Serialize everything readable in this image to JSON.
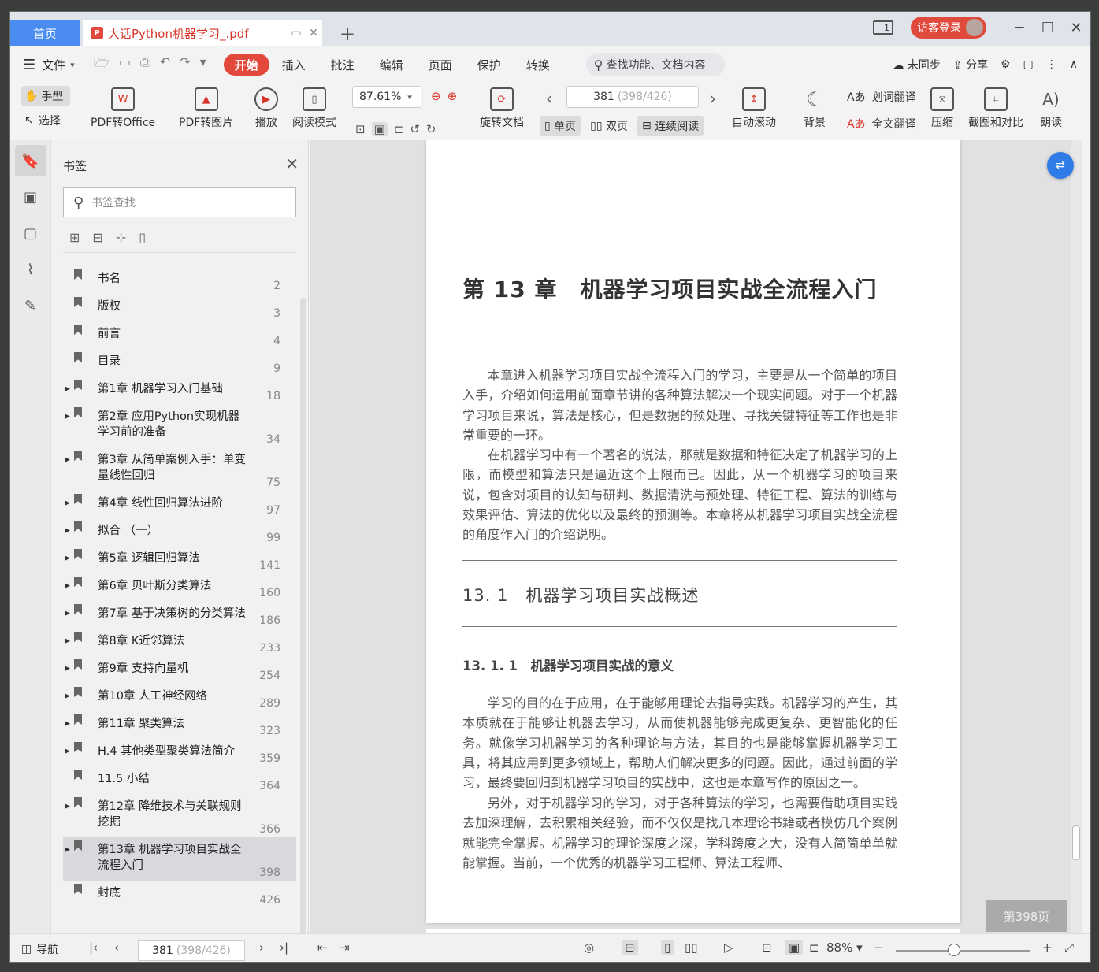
{
  "titlebar": {
    "home_tab": "首页",
    "doc_tab": "大话Python机器学习_.pdf",
    "pdf_badge": "P",
    "login": "访客登录",
    "page_indicator": "1"
  },
  "menu": {
    "file": "文件",
    "tabs": [
      "开始",
      "插入",
      "批注",
      "编辑",
      "页面",
      "保护",
      "转换"
    ],
    "search_placeholder": "查找功能、文档内容",
    "sync": "未同步",
    "share": "分享"
  },
  "toolbar": {
    "hand": "手型",
    "select": "选择",
    "pdf_to_office": "PDF转Office",
    "pdf_to_image": "PDF转图片",
    "play": "播放",
    "read_mode": "阅读模式",
    "zoom": "87.61%",
    "rotate": "旋转文档",
    "page_current": "381",
    "page_detail": "(398/426)",
    "single": "单页",
    "double": "双页",
    "continuous": "连续阅读",
    "auto_scroll": "自动滚动",
    "background": "背景",
    "word_translate": "划词翻译",
    "full_translate": "全文翻译",
    "compress": "压缩",
    "screenshot_compare": "截图和对比",
    "read_aloud": "朗读"
  },
  "panel": {
    "title": "书签",
    "search_placeholder": "书签查找",
    "items": [
      {
        "label": "书名",
        "page": "2",
        "expand": false
      },
      {
        "label": "版权",
        "page": "3",
        "expand": false
      },
      {
        "label": "前言",
        "page": "4",
        "expand": false
      },
      {
        "label": "目录",
        "page": "9",
        "expand": false
      },
      {
        "label": "第1章 机器学习入门基础",
        "page": "18",
        "expand": true
      },
      {
        "label": "第2章 应用Python实现机器学习前的准备",
        "page": "34",
        "expand": true
      },
      {
        "label": "第3章 从简单案例入手：单变量线性回归",
        "page": "75",
        "expand": true
      },
      {
        "label": "第4章 线性回归算法进阶",
        "page": "97",
        "expand": true
      },
      {
        "label": "拟合 （一）",
        "page": "99",
        "expand": true
      },
      {
        "label": "第5章 逻辑回归算法",
        "page": "141",
        "expand": true
      },
      {
        "label": "第6章 贝叶斯分类算法",
        "page": "160",
        "expand": true
      },
      {
        "label": "第7章 基于决策树的分类算法",
        "page": "186",
        "expand": true
      },
      {
        "label": "第8章 K近邻算法",
        "page": "233",
        "expand": true
      },
      {
        "label": "第9章 支持向量机",
        "page": "254",
        "expand": true
      },
      {
        "label": "第10章 人工神经网络",
        "page": "289",
        "expand": true
      },
      {
        "label": "第11章 聚类算法",
        "page": "323",
        "expand": true
      },
      {
        "label": "H.4 其他类型聚类算法简介",
        "page": "359",
        "expand": true
      },
      {
        "label": "11.5 小结",
        "page": "364",
        "expand": false
      },
      {
        "label": "第12章 降维技术与关联规则挖掘",
        "page": "366",
        "expand": true
      },
      {
        "label": "第13章 机器学习项目实战全流程入门",
        "page": "398",
        "expand": true
      },
      {
        "label": "封底",
        "page": "426",
        "expand": false
      }
    ]
  },
  "document": {
    "chapter_title": "第 13 章　机器学习项目实战全流程入门",
    "p1": "本章进入机器学习项目实战全流程入门的学习，主要是从一个简单的项目入手，介绍如何运用前面章节讲的各种算法解决一个现实问题。对于一个机器学习项目来说，算法是核心，但是数据的预处理、寻找关键特征等工作也是非常重要的一环。",
    "p2": "在机器学习中有一个著名的说法，那就是数据和特征决定了机器学习的上限，而模型和算法只是逼近这个上限而已。因此，从一个机器学习的项目来说，包含对项目的认知与研判、数据清洗与预处理、特征工程、算法的训练与效果评估、算法的优化以及最终的预测等。本章将从机器学习项目实战全流程的角度作入门的介绍说明。",
    "section": "13. 1　机器学习项目实战概述",
    "subsection": "13. 1. 1　机器学习项目实战的意义",
    "p3": "学习的目的在于应用，在于能够用理论去指导实践。机器学习的产生，其本质就在于能够让机器去学习，从而使机器能够完成更复杂、更智能化的任务。就像学习机器学习的各种理论与方法，其目的也是能够掌握机器学习工具，将其应用到更多领域上，帮助人们解决更多的问题。因此，通过前面的学习，最终要回归到机器学习项目的实战中，这也是本章写作的原因之一。",
    "p4": "另外，对于机器学习的学习，对于各种算法的学习，也需要借助项目实践去加深理解，去积累相关经验，而不仅仅是找几本理论书籍或者模仿几个案例就能完全掌握。机器学习的理论深度之深，学科跨度之大，没有人简简单单就能掌握。当前，一个优秀的机器学习工程师、算法工程师、",
    "page_tip": "第398页"
  },
  "status": {
    "nav": "导航",
    "page_current": "381",
    "page_detail": "(398/426)",
    "zoom": "88%"
  }
}
